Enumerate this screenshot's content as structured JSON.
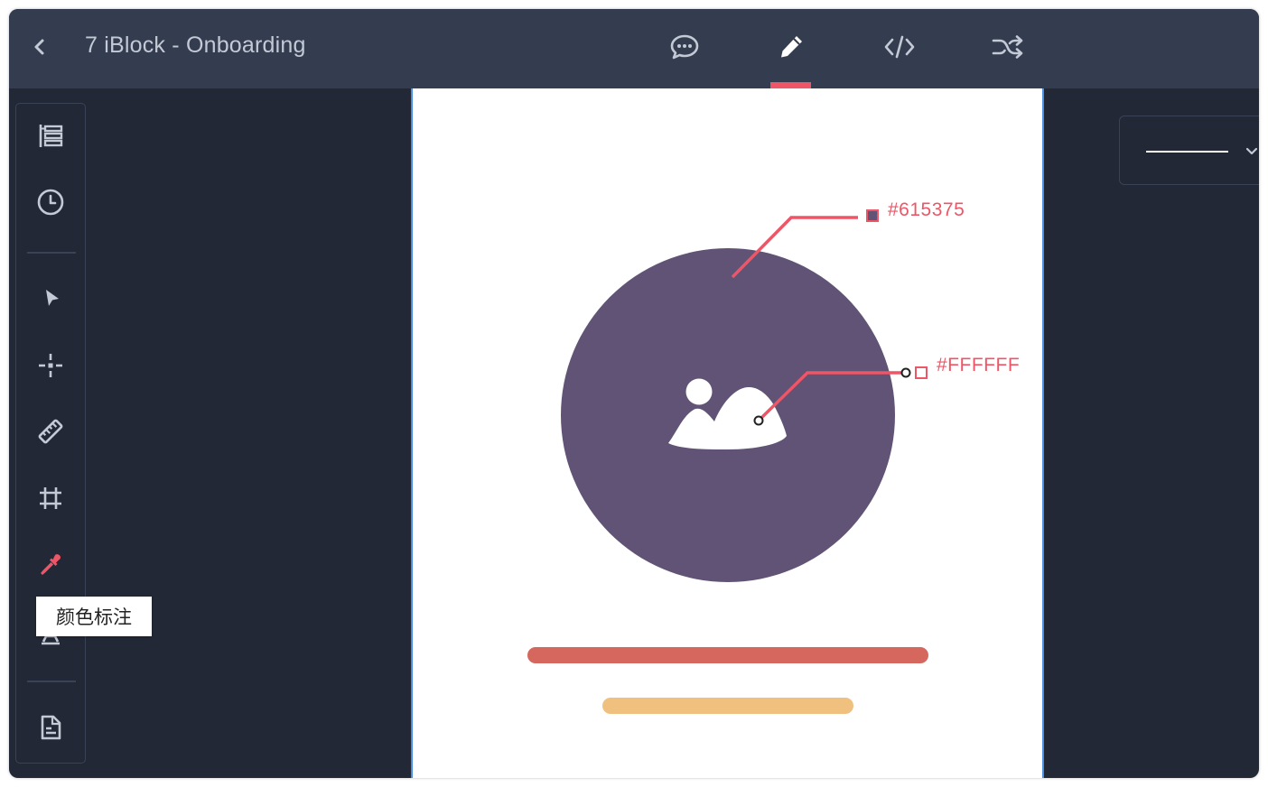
{
  "header": {
    "title": "7 iBlock - Onboarding",
    "back_icon": "chevron-left-icon",
    "tabs": [
      {
        "name": "comments",
        "icon": "comment-icon"
      },
      {
        "name": "design",
        "icon": "pencil-icon",
        "active": true
      },
      {
        "name": "code",
        "icon": "code-icon"
      },
      {
        "name": "flow",
        "icon": "shuffle-icon"
      }
    ]
  },
  "toolbar": {
    "tools": [
      {
        "name": "layers",
        "icon": "layers-icon"
      },
      {
        "name": "history",
        "icon": "clock-icon"
      },
      {
        "name": "select",
        "icon": "cursor-icon"
      },
      {
        "name": "crosshair",
        "icon": "crosshair-icon"
      },
      {
        "name": "measure",
        "icon": "ruler-icon"
      },
      {
        "name": "artboard",
        "icon": "crop-icon"
      },
      {
        "name": "color-annotation",
        "icon": "eyedropper-icon",
        "active": true
      },
      {
        "name": "export",
        "icon": "document-icon"
      }
    ],
    "tooltip": "颜色标注"
  },
  "canvas": {
    "annotations": [
      {
        "label": "#615375",
        "swatch": "#615375"
      },
      {
        "label": "#FFFFFF",
        "swatch": "#FFFFFF"
      }
    ]
  },
  "properties": {
    "line_style": "solid"
  },
  "colors": {
    "topbar": "#343d4f",
    "background": "#222835",
    "accent": "#ee5567",
    "circle": "#615375",
    "bar_primary": "#d5675e",
    "bar_secondary": "#f0c07e"
  }
}
